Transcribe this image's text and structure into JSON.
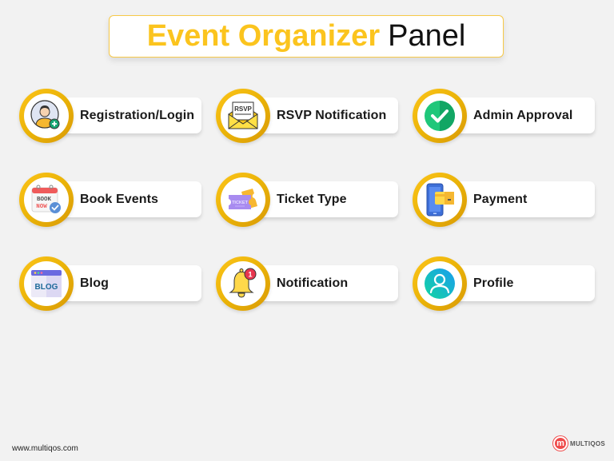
{
  "header": {
    "title_accent": "Event Organizer",
    "title_rest": "Panel"
  },
  "colors": {
    "accent": "#fbc41e",
    "ring": "#eab308",
    "brand": "#ef4b4b"
  },
  "features": [
    {
      "label": "Registration/Login",
      "icon": "user-add-icon"
    },
    {
      "label": "RSVP Notification",
      "icon": "rsvp-envelope-icon"
    },
    {
      "label": "Admin Approval",
      "icon": "check-circle-icon"
    },
    {
      "label": "Book Events",
      "icon": "book-now-calendar-icon"
    },
    {
      "label": "Ticket Type",
      "icon": "ticket-icon"
    },
    {
      "label": "Payment",
      "icon": "phone-card-payment-icon"
    },
    {
      "label": "Blog",
      "icon": "blog-window-icon"
    },
    {
      "label": "Notification",
      "icon": "bell-badge-icon"
    },
    {
      "label": "Profile",
      "icon": "profile-user-icon"
    }
  ],
  "icon_text": {
    "rsvp": "RSVP",
    "book": "BOOK",
    "now": "NOW",
    "ticket": "TICKET",
    "blog": "BLOG",
    "badge": "1"
  },
  "footer": {
    "url": "www.multiqos.com",
    "brand_mark": "m",
    "brand_name": "MULTIQOS"
  }
}
